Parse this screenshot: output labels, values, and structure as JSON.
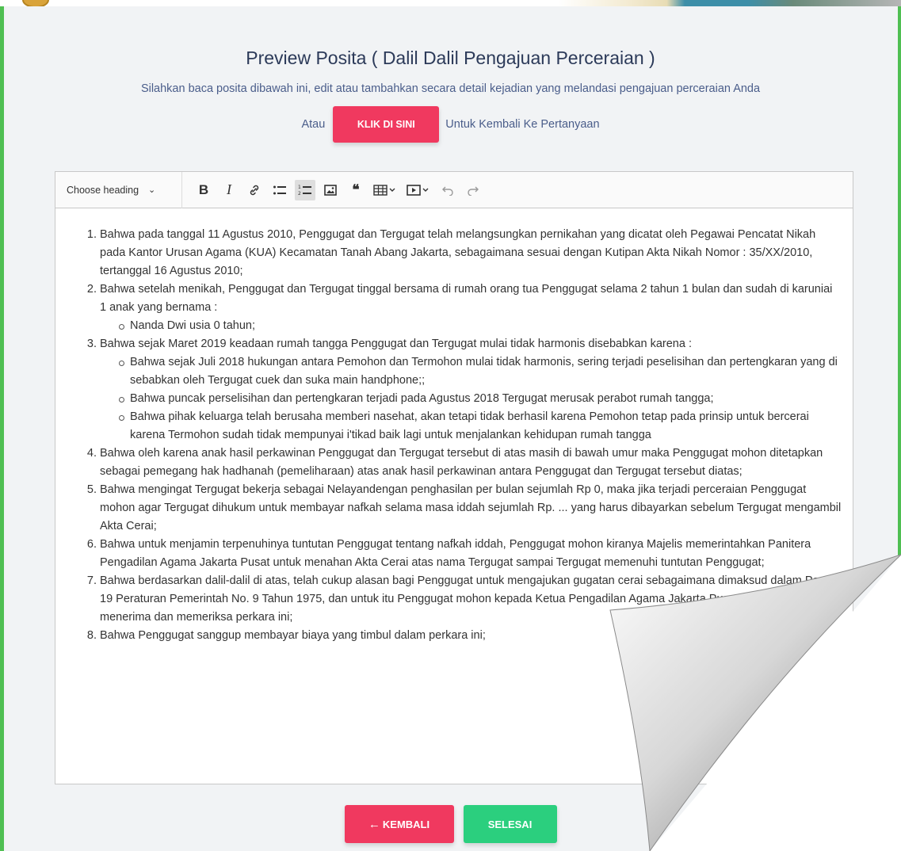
{
  "header": {
    "title": "Preview Posita ( Dalil Dalil Pengajuan Perceraian )",
    "subtitle": "Silahkan baca posita dibawah ini, edit atau tambahkan secara detail kejadian yang melandasi pengajuan perceraian Anda",
    "atau": "Atau",
    "klik_label": "KLIK DI SINI",
    "back_to_questions": "Untuk Kembali Ke Pertanyaan"
  },
  "toolbar": {
    "heading_select": "Choose heading",
    "icons": [
      "bold-icon",
      "italic-icon",
      "link-icon",
      "bulleted-list-icon",
      "numbered-list-icon",
      "image-icon",
      "blockquote-icon",
      "table-icon",
      "media-icon",
      "undo-icon",
      "redo-icon"
    ]
  },
  "editor": {
    "items": [
      "Bahwa pada tanggal 11 Agustus 2010, Penggugat dan Tergugat telah melangsungkan pernikahan yang dicatat oleh Pegawai Pencatat Nikah pada Kantor Urusan Agama (KUA) Kecamatan Tanah Abang Jakarta, sebagaimana sesuai dengan Kutipan Akta Nikah Nomor : 35/XX/2010, tertanggal 16 Agustus 2010;",
      "Bahwa setelah menikah, Penggugat dan Tergugat tinggal bersama di rumah orang tua Penggugat selama 2 tahun 1 bulan dan sudah di karuniai 1 anak yang bernama :",
      "Bahwa sejak Maret 2019 keadaan rumah tangga Penggugat dan Tergugat mulai tidak harmonis disebabkan karena :",
      "Bahwa oleh karena anak hasil perkawinan Penggugat dan Tergugat tersebut di atas masih di bawah umur maka Penggugat mohon ditetapkan sebagai pemegang hak hadhanah (pemeliharaan) atas anak hasil perkawinan antara Penggugat dan Tergugat tersebut diatas;",
      "Bahwa mengingat Tergugat bekerja sebagai Nelayandengan penghasilan per bulan sejumlah Rp 0, maka jika terjadi perceraian Penggugat mohon agar Tergugat dihukum untuk membayar nafkah selama masa iddah sejumlah Rp. ...",
      "Bahwa untuk menjamin terpenuhinya tuntutan Penggugat tentang nafkah iddah, Penggugat mohon kiranya Majelis memerintahkan Panitera Pengadilan Agama Jakarta Pusat untuk menahan Akta Cerai atas nama Tergugat sampai Tergugat memenuhi tuntutan Penggugat;",
      "Bahwa berdasarkan dalil-dalil di atas, telah cukup alasan bagi Penggugat untuk mengajukan gugatan cerai sebagaimana dimaksud dalam Pasal 19 Peraturan Pemerintah No. 9 Tahun 1975, dan untuk itu Penggugat mohon kepada Ketua Pengadilan Agama Jakarta Pusat kiranya berkenan menerima dan memeriksa perkara ini;",
      "Bahwa Penggugat sanggup membayar biaya yang timbul dalam perkara ini;"
    ],
    "item5_tail": "yang harus dibayarkan sebelum Tergugat mengambil Akta Cerai;",
    "sub2": [
      "Nanda Dwi usia 0 tahun;"
    ],
    "sub3": [
      "Bahwa sejak Juli 2018 hukungan antara Pemohon dan Termohon mulai tidak harmonis, sering terjadi peselisihan dan pertengkaran yang di sebabkan oleh Tergugat cuek dan suka main handphone;;",
      "Bahwa puncak perselisihan dan pertengkaran terjadi pada Agustus 2018 Tergugat merusak perabot rumah tangga;",
      "Bahwa pihak keluarga telah berusaha memberi nasehat, akan tetapi tidak berhasil karena Pemohon tetap pada prinsip untuk bercerai karena Termohon sudah tidak mempunyai i'tikad baik lagi untuk menjalankan kehidupan rumah tangga"
    ]
  },
  "footer": {
    "back_label": "KEMBALI",
    "back_arrow": "←",
    "done_label": "SELESAI"
  },
  "colors": {
    "accent_red": "#f0395f",
    "accent_green": "#2bcf7e",
    "frame_green": "#4fbf52",
    "title": "#2c3a59"
  }
}
